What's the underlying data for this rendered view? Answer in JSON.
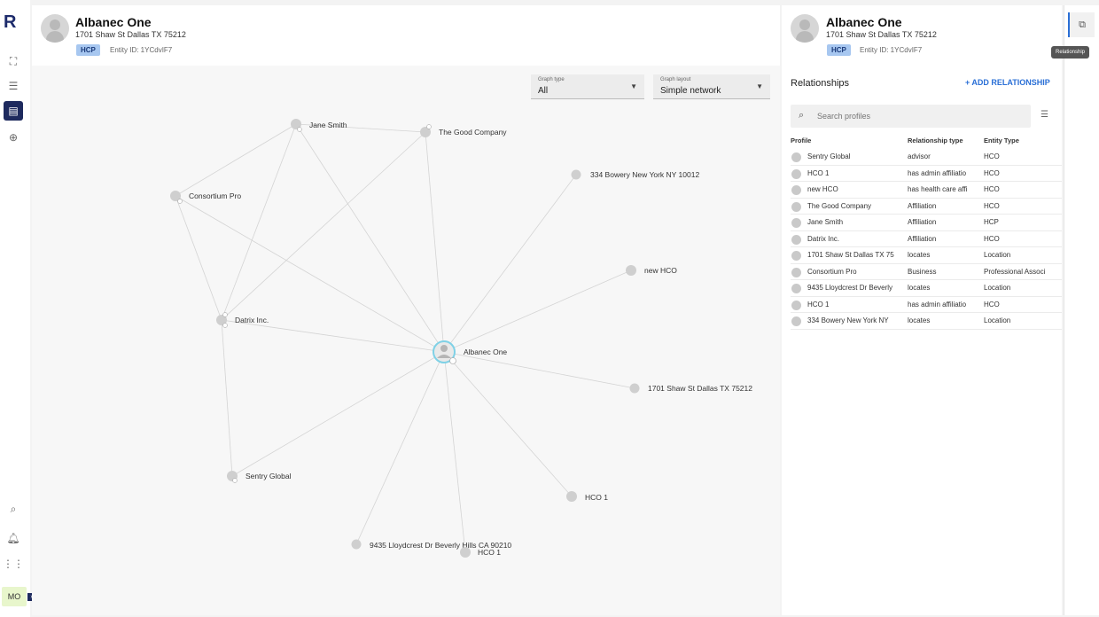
{
  "rail": {
    "logo": "R",
    "user_initials": "MO",
    "items": [
      "map-icon",
      "search-list-icon",
      "dashboard-icon",
      "add-circle-icon"
    ],
    "bottom_items": [
      "search-icon",
      "bell-icon",
      "apps-grid-icon"
    ]
  },
  "main": {
    "profile": {
      "name": "Albanec One",
      "address": "1701 Shaw St Dallas TX 75212",
      "badge": "HCP",
      "entity_id": "Entity ID: 1YCdvIF7"
    },
    "graph_type": {
      "label": "Graph type",
      "value": "All"
    },
    "graph_layout": {
      "label": "Graph layout",
      "value": "Simple network"
    },
    "nodes": {
      "center": "Albanec One",
      "jane": "Jane Smith",
      "goodco": "The Good Company",
      "bowery": "334 Bowery New York NY 10012",
      "consortium": "Consortium Pro",
      "newhco": "new HCO",
      "datrix": "Datrix Inc.",
      "shaw": "1701 Shaw St Dallas TX 75212",
      "sentry": "Sentry Global",
      "hco1a": "HCO 1",
      "lloyd": "9435 Lloydcrest Dr Beverly Hills CA 90210",
      "hco1b": "HCO 1"
    }
  },
  "panel": {
    "profile": {
      "name": "Albanec One",
      "address": "1701 Shaw St Dallas TX 75212",
      "badge": "HCP",
      "entity_id": "Entity ID: 1YCdvIF7"
    },
    "title": "Relationships",
    "add_label": "+ ADD RELATIONSHIP",
    "search_placeholder": "Search profiles",
    "columns": [
      "Profile",
      "Relationship type",
      "Entity Type"
    ],
    "rows": [
      [
        "Sentry Global",
        "advisor",
        "HCO"
      ],
      [
        "HCO 1",
        "has admin affiliatio",
        "HCO"
      ],
      [
        "new HCO",
        "has health care affi",
        "HCO"
      ],
      [
        "The Good Company",
        "Affiliation",
        "HCO"
      ],
      [
        "Jane Smith",
        "Affiliation",
        "HCP"
      ],
      [
        "Datrix Inc.",
        "Affiliation",
        "HCO"
      ],
      [
        "1701 Shaw St Dallas TX 75",
        "locates",
        "Location"
      ],
      [
        "Consortium Pro",
        "Business",
        "Professional Associ"
      ],
      [
        "9435 Lloydcrest Dr Beverly",
        "locates",
        "Location"
      ],
      [
        "HCO 1",
        "has admin affiliatio",
        "HCO"
      ],
      [
        "334 Bowery New York NY",
        "locates",
        "Location"
      ]
    ]
  },
  "tooltip": "Relationship",
  "colors": {
    "accent": "#2a6fd6",
    "rail_active": "#1e2a5e",
    "center_ring": "#7fd1e6",
    "badge_bg": "#a7c7f0"
  }
}
